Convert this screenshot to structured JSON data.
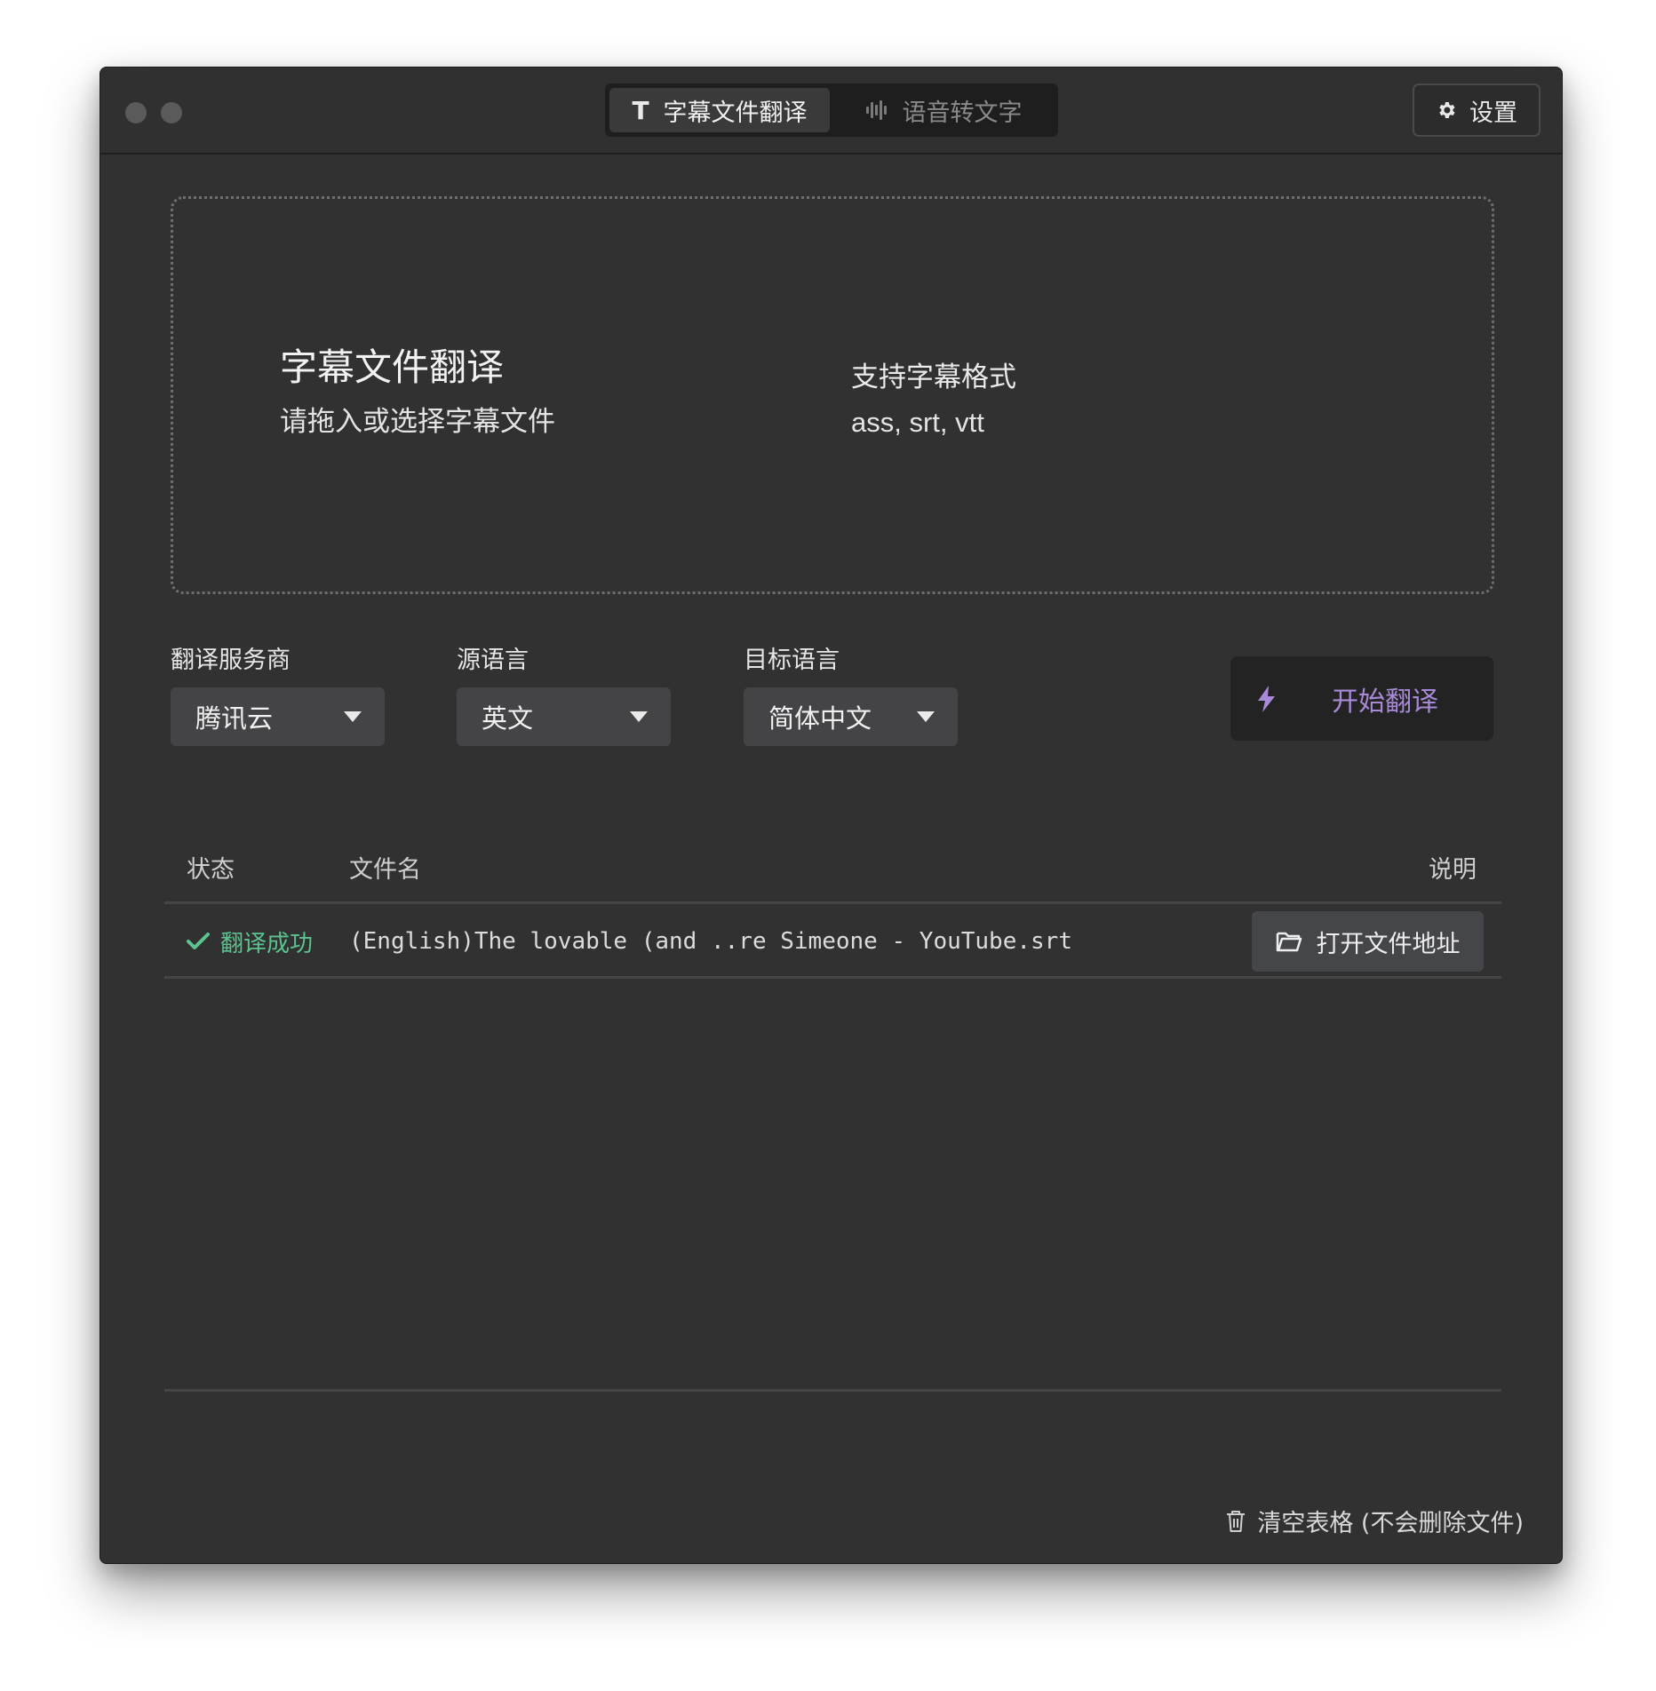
{
  "titlebar": {
    "tabs": [
      {
        "label": "字幕文件翻译",
        "icon": "text-icon",
        "active": true
      },
      {
        "label": "语音转文字",
        "icon": "waveform-icon",
        "active": false
      }
    ],
    "text_icon_glyph": "T",
    "settings_label": "设置"
  },
  "dropzone": {
    "title": "字幕文件翻译",
    "subtitle": "请拖入或选择字幕文件",
    "formats_label": "支持字幕格式",
    "formats": "ass, srt, vtt"
  },
  "options": {
    "provider": {
      "label": "翻译服务商",
      "value": "腾讯云"
    },
    "source": {
      "label": "源语言",
      "value": "英文"
    },
    "target": {
      "label": "目标语言",
      "value": "简体中文"
    }
  },
  "start_button": {
    "label": "开始翻译"
  },
  "table": {
    "headers": {
      "status": "状态",
      "name": "文件名",
      "desc": "说明"
    },
    "rows": [
      {
        "status": "翻译成功",
        "name": "(English)The lovable (and ..re Simeone - YouTube.srt",
        "action": "打开文件地址"
      }
    ]
  },
  "footer": {
    "clear_label": "清空表格 (不会删除文件)"
  },
  "colors": {
    "window_bg": "#313131",
    "success": "#5cc38f",
    "accent_purple": "#a88ad8"
  }
}
